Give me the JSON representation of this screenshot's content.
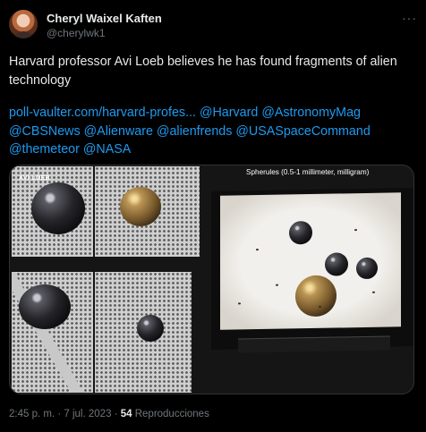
{
  "author": {
    "name": "Cheryl Waixel Kaften",
    "handle": "@cherylwk1",
    "avatar_icon": "avatar-photo"
  },
  "more_icon": "ellipsis-icon",
  "more_label": "···",
  "tweet": {
    "text": "Harvard professor Avi Loeb believes he has found fragments of alien technology",
    "link_parts": [
      "poll-vaulter.com/harvard-profes...",
      "@Harvard",
      "@AstronomyMag",
      "@CBSNews",
      "@Alienware",
      "@alienfrends",
      "@USASpaceCommand",
      "@themeteor",
      "@NASA"
    ]
  },
  "media": {
    "label_avi": "AVI LOEB",
    "spherules_caption": "Spherules (0.5-1 millimeter, milligram)"
  },
  "footer": {
    "time": "2:45 p. m.",
    "separator": "·",
    "date": "7 jul. 2023",
    "views_count": "54",
    "views_label": "Reproducciones"
  },
  "colors": {
    "background": "#000000",
    "text": "#e7e9ea",
    "muted": "#71767b",
    "link": "#1d9bf0"
  }
}
